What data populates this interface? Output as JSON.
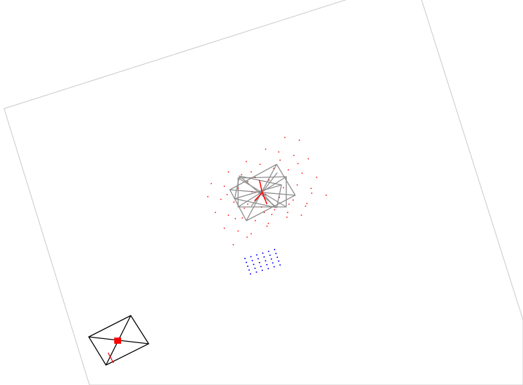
{
  "colors": {
    "background": "#ffffff",
    "frame_outline": "#c8c8c8",
    "overlay_outline": "#8c8c8c",
    "marker_red": "#ff0000",
    "grid_blue": "#0000ff",
    "thumbnail_outline": "#000000"
  },
  "diagram": {
    "has_text": false,
    "red_scatter_count": 60,
    "blue_grid": {
      "rows": 5,
      "cols": 6
    }
  }
}
